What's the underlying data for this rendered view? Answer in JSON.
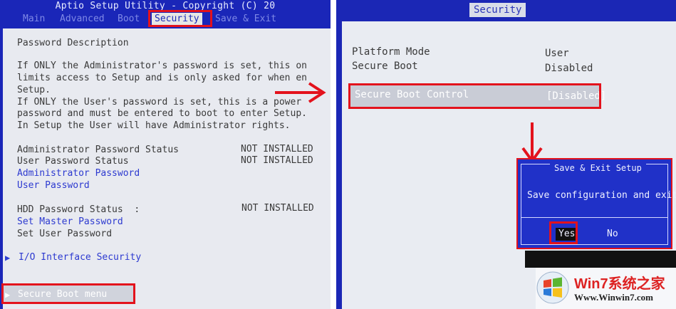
{
  "left": {
    "header_title": "Aptio Setup Utility - Copyright (C) 20",
    "tabs": [
      "Main",
      "Advanced",
      "Boot",
      "Security",
      "Save & Exit"
    ],
    "active_tab": "Security",
    "section_title": "Password Description",
    "description_lines": [
      "If ONLY the Administrator's password is set, this on",
      "limits access to Setup and is only asked for when en",
      "Setup.",
      "If ONLY the User's password is set, this is a power",
      "password and must be entered to boot to enter Setup.",
      "In Setup the User will have Administrator rights."
    ],
    "admin_status_label": "Administrator Password Status",
    "admin_status_value": "NOT INSTALLED",
    "user_status_label": "User Password Status",
    "user_status_value": "NOT INSTALLED",
    "admin_password_link": "Administrator Password",
    "user_password_link": "User Password",
    "hdd_status_label": "HDD Password Status  :",
    "hdd_status_value": "NOT INSTALLED",
    "set_master_password": "Set Master Password",
    "set_user_password": "Set User Password",
    "io_interface_security": "I/O Interface Security",
    "secure_boot_menu": "Secure Boot menu"
  },
  "right": {
    "tab": "Security",
    "platform_mode_label": "Platform Mode",
    "platform_mode_value": "User",
    "secure_boot_label": "Secure Boot",
    "secure_boot_value": "Disabled",
    "secure_boot_control_label": "Secure Boot Control",
    "secure_boot_control_value": "[Disabled]",
    "dialog": {
      "title": "Save & Exit Setup",
      "question": "Save configuration and exit?",
      "yes": "Yes",
      "no": "No"
    }
  },
  "watermark": {
    "brand": "Win7系统之家",
    "url": "Www.Winwin7.com"
  },
  "colors": {
    "bios_blue": "#1a26b8",
    "panel_gray": "#e8eaf0",
    "highlight_red": "#e3121c",
    "link_blue": "#2d3ad0"
  }
}
